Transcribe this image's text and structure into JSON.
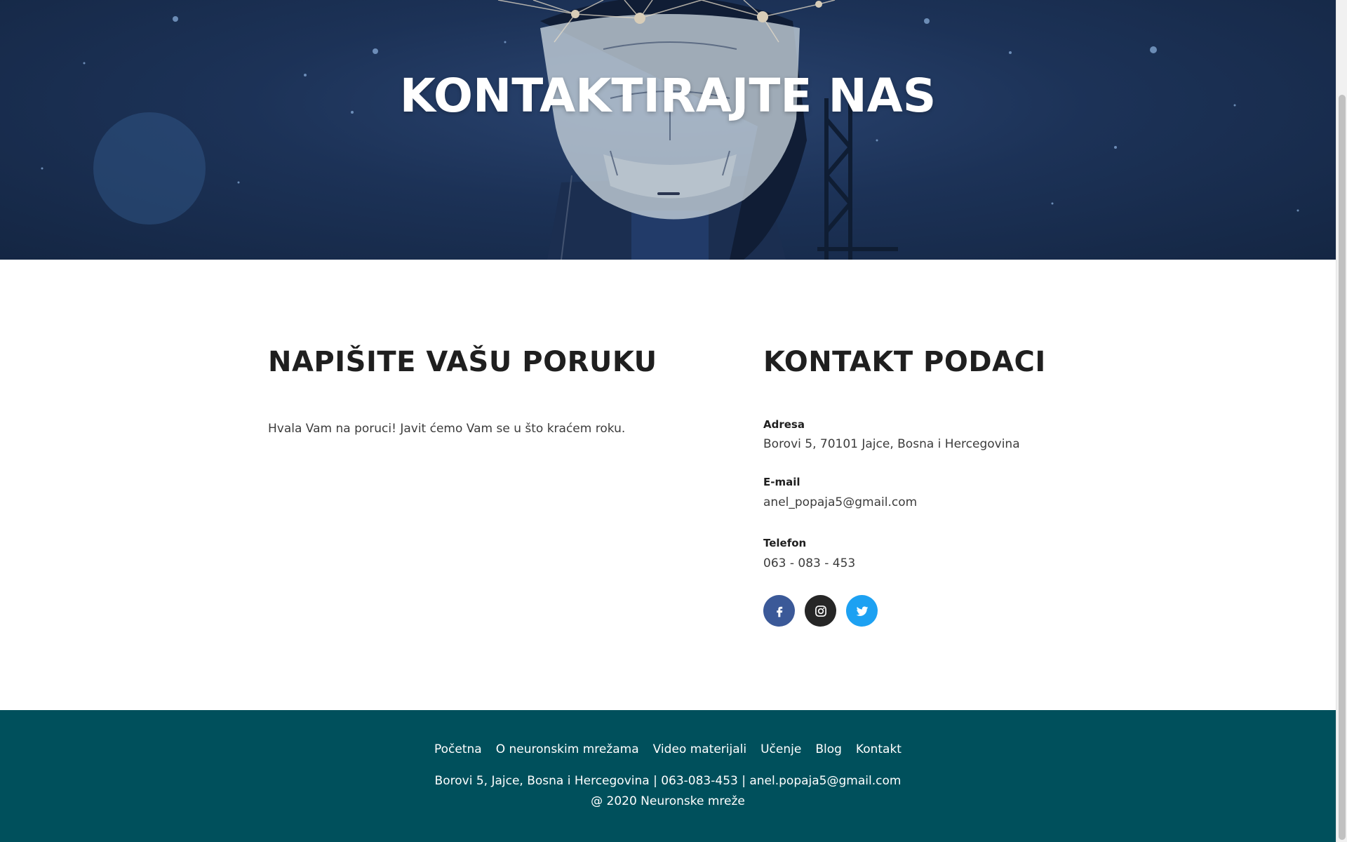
{
  "hero": {
    "title": "KONTAKTIRAJTE NAS"
  },
  "message_section": {
    "title": "NAPIŠITE VAŠU PORUKU",
    "thanks_text": "Hvala Vam na poruci! Javit ćemo Vam se u što kraćem roku."
  },
  "contact_section": {
    "title": "KONTAKT PODACI",
    "address_label": "Adresa",
    "address_value": "Borovi 5, 70101 Jajce, Bosna i Hercegovina",
    "email_label": "E-mail",
    "email_value": "anel_popaja5@gmail.com",
    "phone_label": "Telefon",
    "phone_value": "063 - 083 - 453",
    "social": [
      {
        "icon": "facebook-icon",
        "color": "#3b5998"
      },
      {
        "icon": "instagram-icon",
        "color": "#262626"
      },
      {
        "icon": "twitter-icon",
        "color": "#1da1f2"
      }
    ]
  },
  "footer": {
    "nav": [
      "Početna",
      "O neuronskim mrežama",
      "Video materijali",
      "Učenje",
      "Blog",
      "Kontakt"
    ],
    "contact_line": "Borovi 5, Jajce, Bosna i Hercegovina | 063-083-453 | anel.popaja5@gmail.com",
    "copyright": "@ 2020 Neuronske mreže",
    "background": "#00505c"
  }
}
